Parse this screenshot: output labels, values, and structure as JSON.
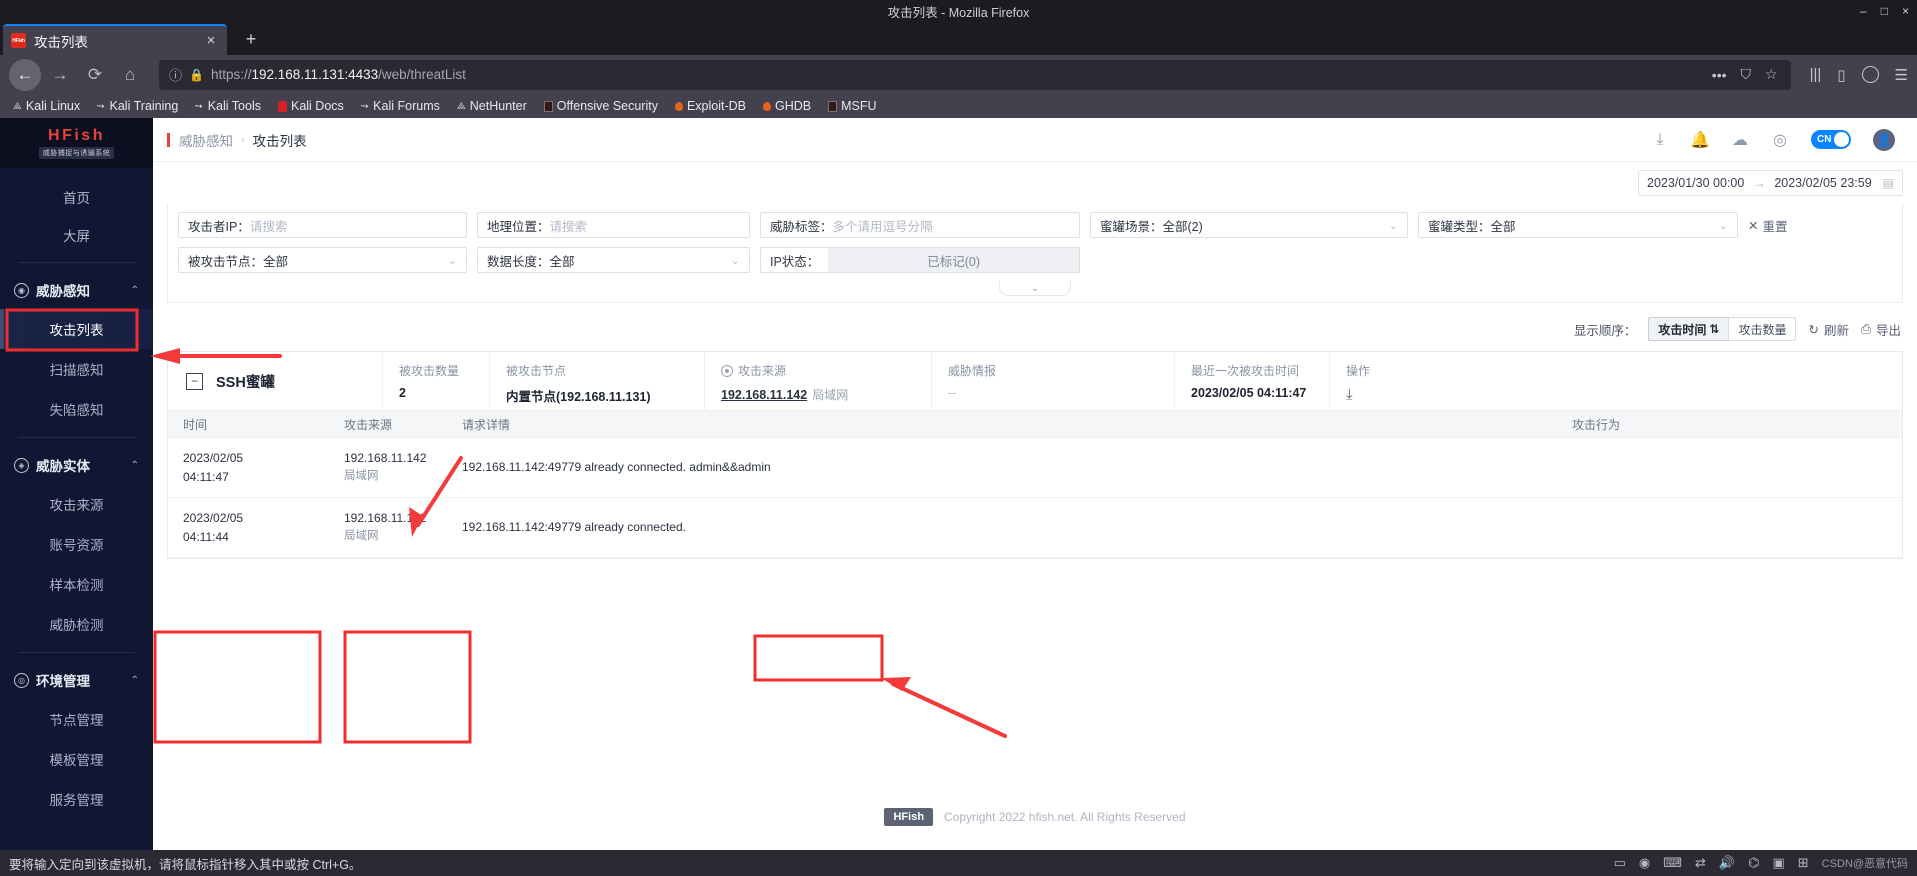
{
  "browser": {
    "window_title": "攻击列表 - Mozilla Firefox",
    "window_min": "–",
    "window_max": "□",
    "window_close": "×",
    "tab": {
      "title": "攻击列表",
      "favicon_label": "HFish",
      "close": "×"
    },
    "new_tab": "+",
    "nav": {
      "back": "←",
      "forward": "→",
      "reload": "⟳",
      "home": "⌂"
    },
    "url": {
      "info_icon": "ⓘ",
      "lock_icon": "🔒",
      "scheme": "https://",
      "host": "192.168.11.131:4433",
      "path": "/web/threatList",
      "full": "https://192.168.11.131:4433/web/threatList"
    },
    "url_actions": {
      "more": "•••",
      "pocket": "⛉",
      "bookmark": "☆"
    },
    "nav_right": {
      "library": "|||",
      "sidebar": "▯",
      "account": "●",
      "menu": "☰"
    },
    "bookmarks": [
      {
        "label": "Kali Linux",
        "icon": "dragon-icon"
      },
      {
        "label": "Kali Training",
        "icon": "wrench-icon"
      },
      {
        "label": "Kali Tools",
        "icon": "wrench-icon"
      },
      {
        "label": "Kali Docs",
        "icon": "red-book-icon"
      },
      {
        "label": "Kali Forums",
        "icon": "wrench-icon"
      },
      {
        "label": "NetHunter",
        "icon": "dragon-icon"
      },
      {
        "label": "Offensive Security",
        "icon": "dark-book-icon"
      },
      {
        "label": "Exploit-DB",
        "icon": "flame-icon"
      },
      {
        "label": "GHDB",
        "icon": "flame-icon"
      },
      {
        "label": "MSFU",
        "icon": "dark-book-icon"
      }
    ]
  },
  "sidebar": {
    "logo_title": "HFish",
    "logo_sub": "威胁捕捉与诱骗系统",
    "links": [
      {
        "label": "首页"
      },
      {
        "label": "大屏"
      }
    ],
    "groups": [
      {
        "label": "威胁感知",
        "icon": "radar-icon",
        "caret": "⌃",
        "items": [
          {
            "label": "攻击列表",
            "active": true
          },
          {
            "label": "扫描感知",
            "active": false
          },
          {
            "label": "失陷感知",
            "active": false
          }
        ]
      },
      {
        "label": "威胁实体",
        "icon": "entity-icon",
        "caret": "⌃",
        "items": [
          {
            "label": "攻击来源",
            "active": false
          },
          {
            "label": "账号资源",
            "active": false
          },
          {
            "label": "样本检测",
            "active": false
          },
          {
            "label": "威胁检测",
            "active": false
          }
        ]
      },
      {
        "label": "环境管理",
        "icon": "env-icon",
        "caret": "⌃",
        "items": [
          {
            "label": "节点管理",
            "active": false
          },
          {
            "label": "模板管理",
            "active": false
          },
          {
            "label": "服务管理",
            "active": false
          }
        ]
      }
    ]
  },
  "header": {
    "breadcrumb_parent": "威胁感知",
    "breadcrumb_sep": "›",
    "breadcrumb_current": "攻击列表",
    "icons": [
      {
        "name": "download-icon",
        "glyph": "⤓"
      },
      {
        "name": "bell-icon",
        "glyph": "🔔"
      },
      {
        "name": "cloud-icon",
        "glyph": "☁"
      },
      {
        "name": "settings-icon",
        "glyph": "◎"
      }
    ],
    "lang_toggle": "CN",
    "avatar_glyph": "👤"
  },
  "date_range": {
    "start": "2023/01/30 00:00",
    "arrow": "→",
    "end": "2023/02/05 23:59",
    "calendar_icon": "▤"
  },
  "filters": {
    "row1": [
      {
        "label": "攻击者IP：",
        "placeholder": "请搜索",
        "type": "input",
        "width": "w1"
      },
      {
        "label": "地理位置：",
        "placeholder": "请搜索",
        "type": "input",
        "width": "w2"
      },
      {
        "label": "威胁标签：",
        "placeholder": "多个请用逗号分隔",
        "type": "input",
        "width": "w3"
      },
      {
        "label": "蜜罐场景：",
        "value": "全部(2)",
        "type": "select",
        "width": "w4",
        "caret": "⌄"
      },
      {
        "label": "蜜罐类型：",
        "value": "全部",
        "type": "select",
        "width": "w5",
        "caret": "⌄"
      }
    ],
    "row2": [
      {
        "label": "被攻击节点：",
        "value": "全部",
        "type": "select",
        "width": "w1",
        "caret": "⌄"
      },
      {
        "label": "数据长度：",
        "value": "全部",
        "type": "select",
        "width": "w2",
        "caret": "⌄"
      },
      {
        "label": "IP状态：",
        "value": "已标记(0)",
        "type": "chip",
        "width": "w3"
      }
    ],
    "reset_label": "重置",
    "reset_icon": "✕",
    "collapse_caret": "⌄"
  },
  "sort_bar": {
    "label": "显示顺序：",
    "options": [
      {
        "label": "攻击时间",
        "active": true,
        "sort_glyph": "⇅"
      },
      {
        "label": "攻击数量",
        "active": false
      }
    ],
    "refresh": {
      "label": "刷新",
      "icon": "↻"
    },
    "export": {
      "label": "导出",
      "icon": "⎙"
    }
  },
  "honeypot_card": {
    "collapse_glyph": "−",
    "name": "SSH蜜罐",
    "stats": [
      {
        "label": "被攻击数量",
        "value": "2",
        "type": "bold"
      },
      {
        "label": "被攻击节点",
        "value": "内置节点(192.168.11.131)",
        "type": "bold"
      },
      {
        "label": "攻击来源",
        "value": "192.168.11.142",
        "tag": "局域网",
        "type": "link",
        "icon": "target-icon"
      },
      {
        "label": "威胁情报",
        "value": "--",
        "type": "plain"
      },
      {
        "label": "最近一次被攻击时间",
        "value": "2023/02/05 04:11:47",
        "type": "bold"
      },
      {
        "label": "操作",
        "value": "",
        "type": "icon",
        "icon_glyph": "⤓"
      }
    ]
  },
  "table": {
    "columns": [
      "时间",
      "攻击来源",
      "请求详情",
      "攻击行为"
    ],
    "rows": [
      {
        "time_date": "2023/02/05",
        "time_clock": "04:11:47",
        "src_ip": "192.168.11.142",
        "src_zone": "局域网",
        "detail": "192.168.11.142:49779 already connected. admin&&admin",
        "behavior": ""
      },
      {
        "time_date": "2023/02/05",
        "time_clock": "04:11:44",
        "src_ip": "192.168.11.142",
        "src_zone": "局域网",
        "detail": "192.168.11.142:49779 already connected.",
        "behavior": ""
      }
    ]
  },
  "footer": {
    "logo": "HFish",
    "copyright": "Copyright 2022 hfish.net. All Rights Reserved"
  },
  "statusbar": {
    "message": "要将输入定向到该虚拟机，请将鼠标指针移入其中或按 Ctrl+G。",
    "icons": [
      "▭",
      "◉",
      "⌨",
      "⇄",
      "🔊",
      "⌬",
      "▣",
      "⊞"
    ],
    "watermark": "CSDN@恶意代码"
  },
  "colors": {
    "accent_red": "#e8403a",
    "sidebar_bg": "#0f1733",
    "annotation": "#ee2d2d",
    "toggle_blue": "#0a84ff"
  }
}
